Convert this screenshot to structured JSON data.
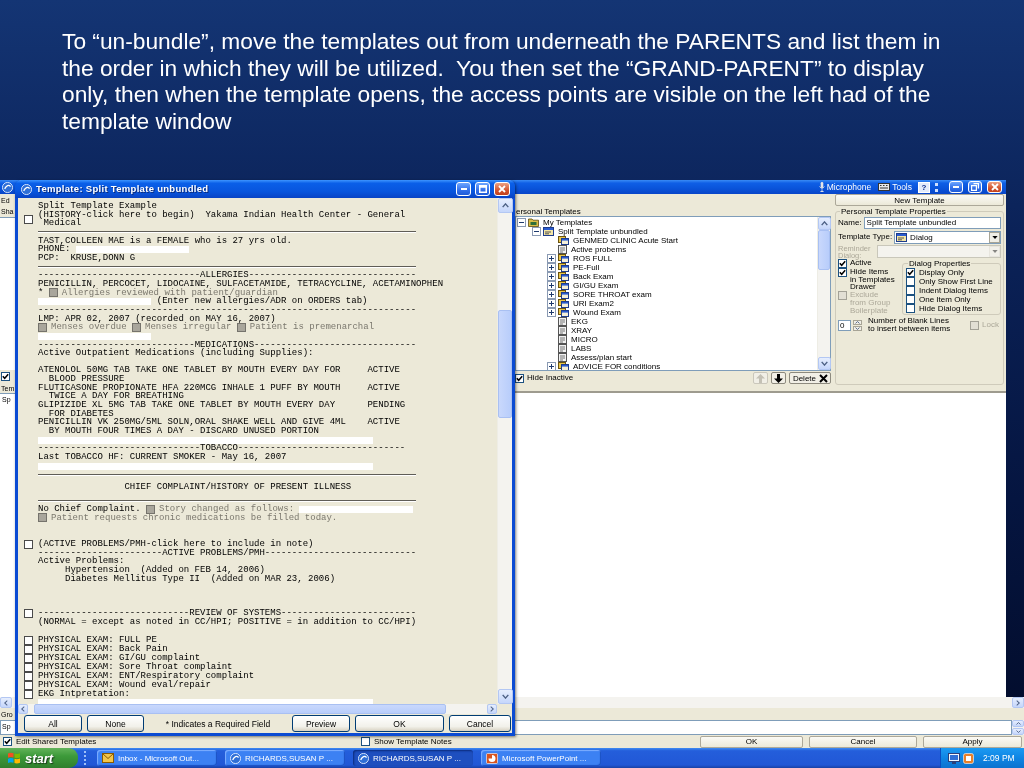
{
  "caption": "To “un-bundle”, move the templates out from underneath the PARENTS and list them in the order in which they will be utilized.  You then set the “GRAND-PARENT” to display only, then when the template opens, the access points are visible on the left had of the template window",
  "editor_window": {
    "toolbar": [
      {
        "kind": "microphone",
        "label": "Microphone"
      },
      {
        "kind": "tools",
        "label": "Tools"
      },
      {
        "kind": "help",
        "label": "?"
      }
    ],
    "left_edge": {
      "menu_item": "Ed",
      "label": "Sha",
      "toggle": {
        "checked": true
      },
      "list_label": "Tem",
      "list_items": [
        "Sp"
      ],
      "group_label": "Gro",
      "notes_value": "Sp"
    },
    "new_template_button": "New Template",
    "tree": {
      "label": "ersonal Templates",
      "nodes": [
        {
          "label": "My Templates",
          "kind": "root",
          "expanded": true,
          "children": [
            {
              "label": "Split Template unbundled",
              "kind": "dialog",
              "expanded": true,
              "children": [
                {
                  "label": "GENMED CLINIC Acute Start",
                  "kind": "group"
                },
                {
                  "label": "Active probems",
                  "kind": "template"
                },
                {
                  "label": "ROS FULL",
                  "kind": "group",
                  "expanded": false
                },
                {
                  "label": "PE-Full",
                  "kind": "group",
                  "expanded": false
                },
                {
                  "label": "Back Exam",
                  "kind": "group",
                  "expanded": false
                },
                {
                  "label": "GI/GU Exam",
                  "kind": "group",
                  "expanded": false
                },
                {
                  "label": "SORE THROAT exam",
                  "kind": "group",
                  "expanded": false
                },
                {
                  "label": "URI Exam2",
                  "kind": "group",
                  "expanded": false
                },
                {
                  "label": "Wound Exam",
                  "kind": "group",
                  "expanded": false
                },
                {
                  "label": "EKG",
                  "kind": "template"
                },
                {
                  "label": "XRAY",
                  "kind": "template"
                },
                {
                  "label": "MICRO",
                  "kind": "template"
                },
                {
                  "label": "LABS",
                  "kind": "template"
                },
                {
                  "label": "Assess/plan start",
                  "kind": "template"
                },
                {
                  "label": "ADVICE FOR conditions",
                  "kind": "group",
                  "expanded": false
                }
              ]
            }
          ]
        }
      ]
    },
    "hide_inactive": {
      "label": "Hide Inactive",
      "checked": true
    },
    "move_buttons": [
      {
        "kind": "up",
        "disabled": true
      },
      {
        "kind": "down",
        "disabled": false
      }
    ],
    "delete_button": "Delete",
    "properties": {
      "title": "Personal Template Properties",
      "name": {
        "label": "Name:",
        "value": "Split Template unbundled"
      },
      "template_type": {
        "label": "Template Type:",
        "value": "Dialog"
      },
      "reminder_dialog": {
        "label": "Reminder Dialog:",
        "disabled": true
      },
      "flags": [
        {
          "label": "Active",
          "checked": true,
          "disabled": false
        },
        {
          "label": "Hide Items in Templates Drawer",
          "checked": true,
          "disabled": false
        },
        {
          "label": "Exclude from Group Boilerplate",
          "checked": false,
          "disabled": true
        }
      ],
      "dialog_properties": {
        "title": "Dialog Properties",
        "options": [
          {
            "label": "Display Only",
            "checked": true
          },
          {
            "label": "Only Show First Line",
            "checked": false
          },
          {
            "label": "Indent Dialog Items",
            "checked": false
          },
          {
            "label": "One Item Only",
            "checked": false
          },
          {
            "label": "Hide Dialog Items",
            "checked": false
          }
        ]
      },
      "blank_lines": {
        "value": "0",
        "label": "Number of Blank Lines to insert between items"
      },
      "lock": {
        "label": "Lock",
        "checked": false,
        "disabled": true
      }
    },
    "footer": {
      "edit_shared": {
        "label": "Edit Shared Templates",
        "checked": true
      },
      "show_notes": {
        "label": "Show Template Notes",
        "checked": false
      },
      "buttons": [
        "OK",
        "Cancel",
        "Apply"
      ]
    }
  },
  "template_dialog": {
    "title": "Template: Split Template unbundled",
    "lines": [
      {
        "kind": "line",
        "parts": [
          {
            "kind": "text",
            "text": "Split Template Example"
          }
        ]
      },
      {
        "kind": "para",
        "toggle": {
          "checked": false
        },
        "text": "(HISTORY-click here to begin)  Yakama Indian Health Center - General Medical"
      },
      {
        "kind": "rule"
      },
      {
        "kind": "line",
        "parts": [
          {
            "kind": "text",
            "text": "TAST,COLLEEN MAE is a FEMALE who is 27 yrs old."
          }
        ]
      },
      {
        "kind": "line",
        "parts": [
          {
            "kind": "text",
            "text": "PHONE:"
          },
          {
            "kind": "field",
            "wide": false
          }
        ]
      },
      {
        "kind": "line",
        "parts": [
          {
            "kind": "text",
            "text": "PCP:  KRUSE,DONN G"
          }
        ]
      },
      {
        "kind": "rule"
      },
      {
        "kind": "line",
        "parts": [
          {
            "kind": "text",
            "text": "------------------------------ALLERGIES-------------------------------"
          }
        ]
      },
      {
        "kind": "line",
        "parts": [
          {
            "kind": "text",
            "text": "PENICILLIN, PERCOCET, LIDOCAINE, SULFACETAMIDE, TETRACYCLINE, ACETAMINOPHEN"
          }
        ]
      },
      {
        "kind": "line",
        "parts": [
          {
            "kind": "text",
            "text": "*"
          },
          {
            "kind": "check",
            "label": "Allergies reviewed with patient/guardian",
            "checked": false,
            "disabled": true
          }
        ]
      },
      {
        "kind": "line",
        "parts": [
          {
            "kind": "field",
            "wide": false
          },
          {
            "kind": "text",
            "text": "(Enter new allergies/ADR on ORDERS tab)"
          }
        ]
      },
      {
        "kind": "line",
        "parts": [
          {
            "kind": "text",
            "text": "----------------------------------------------------------------------"
          }
        ]
      },
      {
        "kind": "line",
        "parts": [
          {
            "kind": "text",
            "text": "LMP: APR 02, 2007 (recorded on MAY 16, 2007)"
          }
        ]
      },
      {
        "kind": "line",
        "parts": [
          {
            "kind": "check",
            "label": "Menses overdue",
            "checked": false,
            "disabled": true
          },
          {
            "kind": "check",
            "label": "Menses irregular",
            "checked": false,
            "disabled": true
          },
          {
            "kind": "check",
            "label": "Patient is premenarchal",
            "checked": false,
            "disabled": true
          }
        ]
      },
      {
        "kind": "line",
        "parts": [
          {
            "kind": "field",
            "wide": false
          }
        ]
      },
      {
        "kind": "line",
        "parts": [
          {
            "kind": "text",
            "text": "-----------------------------MEDICATIONS------------------------------"
          }
        ]
      },
      {
        "kind": "line",
        "parts": [
          {
            "kind": "text",
            "text": "Active Outpatient Medications (including Supplies):"
          }
        ]
      },
      {
        "kind": "blank"
      },
      {
        "kind": "med",
        "text": "ATENOLOL 50MG TAB TAKE ONE TABLET BY MOUTH EVERY DAY FOR BLOOD PRESSURE",
        "status": "ACTIVE"
      },
      {
        "kind": "med",
        "text": "FLUTICASONE PROPIONATE HFA 220MCG INHALE 1 PUFF BY MOUTH TWICE A DAY FOR BREATHING",
        "status": "ACTIVE"
      },
      {
        "kind": "med",
        "text": "GLIPIZIDE XL 5MG TAB TAKE ONE TABLET BY MOUTH EVERY DAY FOR DIABETES",
        "status": "PENDING"
      },
      {
        "kind": "med",
        "text": "PENICILLIN VK 250MG/5ML SOLN,ORAL SHAKE WELL AND GIVE 4ML BY MOUTH FOUR TIMES A DAY - DISCARD UNUSED PORTION",
        "status": "ACTIVE"
      },
      {
        "kind": "line",
        "parts": [
          {
            "kind": "field",
            "wide": true
          }
        ]
      },
      {
        "kind": "line",
        "parts": [
          {
            "kind": "text",
            "text": "------------------------------TOBACCO-------------------------------"
          }
        ]
      },
      {
        "kind": "line",
        "parts": [
          {
            "kind": "text",
            "text": "Last TOBACCO HF: CURRENT SMOKER - May 16, 2007"
          }
        ]
      },
      {
        "kind": "line",
        "parts": [
          {
            "kind": "field",
            "wide": true
          }
        ]
      },
      {
        "kind": "rule"
      },
      {
        "kind": "heading",
        "text": "CHIEF COMPLAINT/HISTORY OF PRESENT ILLNESS"
      },
      {
        "kind": "rule"
      },
      {
        "kind": "line",
        "parts": [
          {
            "kind": "text",
            "text": "No Chief Complaint."
          },
          {
            "kind": "check",
            "label": "Story changed as follows:",
            "checked": false,
            "disabled": true
          },
          {
            "kind": "field",
            "wide": false
          }
        ]
      },
      {
        "kind": "line",
        "parts": [
          {
            "kind": "check",
            "label": "Patient requests chronic medications be filled today.",
            "checked": false,
            "disabled": true
          }
        ]
      },
      {
        "kind": "blank"
      },
      {
        "kind": "blank"
      },
      {
        "kind": "line",
        "toggle": {
          "checked": false
        },
        "parts": [
          {
            "kind": "text",
            "text": "(ACTIVE PROBLEMS/PMH-click here to include in note)"
          }
        ]
      },
      {
        "kind": "line",
        "parts": [
          {
            "kind": "text",
            "text": "-----------------------ACTIVE PROBLEMS/PMH----------------------------"
          }
        ]
      },
      {
        "kind": "group",
        "text": "Active Problems:",
        "children": [
          {
            "text": "Hypertension  (Added on FEB 14, 2006)"
          },
          {
            "text": "Diabetes Mellitus Type II  (Added on MAR 23, 2006)"
          }
        ]
      },
      {
        "kind": "blank"
      },
      {
        "kind": "blank"
      },
      {
        "kind": "blank"
      },
      {
        "kind": "line",
        "toggle": {
          "checked": false
        },
        "parts": [
          {
            "kind": "text",
            "text": "----------------------------REVIEW OF SYSTEMS-------------------------"
          }
        ]
      },
      {
        "kind": "line",
        "parts": [
          {
            "kind": "text",
            "text": "(NORMAL = except as noted in CC/HPI; POSITIVE = in addition to CC/HPI)"
          }
        ]
      },
      {
        "kind": "blank"
      },
      {
        "kind": "line",
        "toggle": {
          "checked": false
        },
        "parts": [
          {
            "kind": "text",
            "text": "PHYSICAL EXAM: FULL PE"
          }
        ]
      },
      {
        "kind": "line",
        "toggle": {
          "checked": false
        },
        "parts": [
          {
            "kind": "text",
            "text": "PHYSICAL EXAM: Back Pain"
          }
        ]
      },
      {
        "kind": "line",
        "toggle": {
          "checked": false
        },
        "parts": [
          {
            "kind": "text",
            "text": "PHYSICAL EXAM: GI/GU complaint"
          }
        ]
      },
      {
        "kind": "line",
        "toggle": {
          "checked": false
        },
        "parts": [
          {
            "kind": "text",
            "text": "PHYSICAL EXAM: Sore Throat complaint"
          }
        ]
      },
      {
        "kind": "line",
        "toggle": {
          "checked": false
        },
        "parts": [
          {
            "kind": "text",
            "text": "PHYSICAL EXAM: ENT/Respiratory complaint"
          }
        ]
      },
      {
        "kind": "line",
        "toggle": {
          "checked": false
        },
        "parts": [
          {
            "kind": "text",
            "text": "PHYSICAL EXAM: Wound eval/repair"
          }
        ]
      },
      {
        "kind": "line",
        "toggle": {
          "checked": false
        },
        "parts": [
          {
            "kind": "text",
            "text": "EKG Intpretation:"
          }
        ]
      },
      {
        "kind": "line",
        "parts": [
          {
            "kind": "field",
            "wide": true
          }
        ]
      }
    ],
    "buttons": [
      {
        "kind": "button",
        "label": "All"
      },
      {
        "kind": "button",
        "label": "None"
      },
      {
        "kind": "note",
        "label": "* Indicates a Required Field"
      },
      {
        "kind": "button",
        "label": "Preview"
      },
      {
        "kind": "button",
        "label": "OK"
      },
      {
        "kind": "button",
        "label": "Cancel"
      }
    ]
  },
  "taskbar": {
    "start": "start",
    "tasks": [
      {
        "kind": "mail",
        "label": "Inbox - Microsoft Out...",
        "selected": false
      },
      {
        "kind": "app",
        "label": "RICHARDS,SUSAN P ...",
        "selected": false
      },
      {
        "kind": "app",
        "label": "RICHARDS,SUSAN P ...",
        "selected": true
      },
      {
        "kind": "slides",
        "label": "Microsoft PowerPoint ...",
        "selected": false
      }
    ],
    "clock": "2:09 PM"
  }
}
